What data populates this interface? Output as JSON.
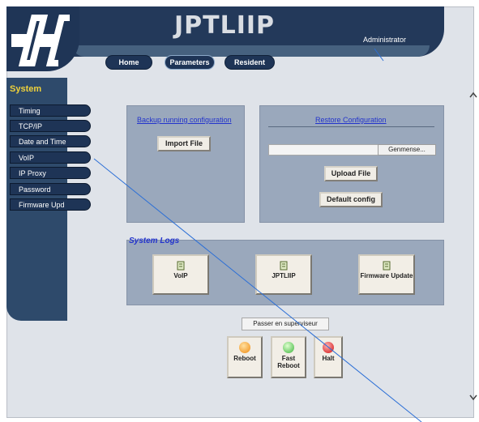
{
  "app": {
    "title": "JPTLIIP",
    "user": "Administrator"
  },
  "nav": {
    "items": [
      "Home",
      "Parameters",
      "Resident"
    ]
  },
  "sidebar": {
    "title": "System",
    "items": [
      "Timing",
      "TCP/IP",
      "Date and Time",
      "VoIP",
      "IP Proxy",
      "Password",
      "Firmware Upd"
    ]
  },
  "backup": {
    "title": "Backup running configuration",
    "import_label": "Import File"
  },
  "restore": {
    "title": "Restore Configuration",
    "browse_label": "Genmense...",
    "upload_label": "Upload File",
    "default_label": "Default config"
  },
  "logs": {
    "title": "System Logs",
    "items": [
      "VoIP",
      "JPTLIIP",
      "Firmware Update"
    ]
  },
  "superviseur_label": "Passer en superviseur",
  "power": {
    "reboot": "Reboot",
    "fast_reboot": "Fast Reboot",
    "halt": "Halt"
  },
  "colors": {
    "accent": "#23395a",
    "link": "#2233cc",
    "sidebar_title": "#f0d23a"
  }
}
